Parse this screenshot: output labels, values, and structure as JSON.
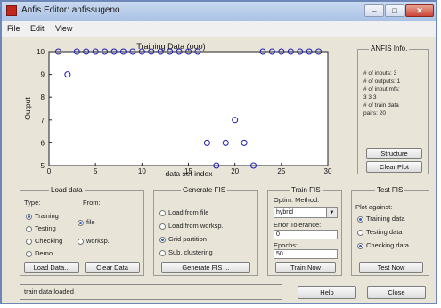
{
  "window": {
    "title": "Anfis Editor: anfissugeno",
    "controls": {
      "minimize": "–",
      "maximize": "□",
      "close": "✕"
    }
  },
  "menu": {
    "file": "File",
    "edit": "Edit",
    "view": "View"
  },
  "chart_data": {
    "type": "scatter",
    "title": "Training Data (ooo)",
    "xlabel": "data set index",
    "ylabel": "Output",
    "xlim": [
      0,
      30
    ],
    "ylim": [
      5,
      10
    ],
    "x_ticks": [
      0,
      5,
      10,
      15,
      20,
      25,
      30
    ],
    "y_ticks": [
      5,
      6,
      7,
      8,
      9,
      10
    ],
    "grid": false,
    "marker": "o",
    "marker_color": "#1a1ab4",
    "points": [
      {
        "x": 1,
        "y": 10
      },
      {
        "x": 2,
        "y": 9
      },
      {
        "x": 3,
        "y": 10
      },
      {
        "x": 4,
        "y": 10
      },
      {
        "x": 5,
        "y": 10
      },
      {
        "x": 6,
        "y": 10
      },
      {
        "x": 7,
        "y": 10
      },
      {
        "x": 8,
        "y": 10
      },
      {
        "x": 9,
        "y": 10
      },
      {
        "x": 10,
        "y": 10
      },
      {
        "x": 11,
        "y": 10
      },
      {
        "x": 12,
        "y": 10
      },
      {
        "x": 13,
        "y": 10
      },
      {
        "x": 14,
        "y": 10
      },
      {
        "x": 15,
        "y": 10
      },
      {
        "x": 16,
        "y": 10
      },
      {
        "x": 17,
        "y": 6
      },
      {
        "x": 18,
        "y": 5
      },
      {
        "x": 19,
        "y": 6
      },
      {
        "x": 20,
        "y": 7
      },
      {
        "x": 21,
        "y": 6
      },
      {
        "x": 22,
        "y": 5
      },
      {
        "x": 23,
        "y": 10
      },
      {
        "x": 24,
        "y": 10
      },
      {
        "x": 25,
        "y": 10
      },
      {
        "x": 26,
        "y": 10
      },
      {
        "x": 27,
        "y": 10
      },
      {
        "x": 28,
        "y": 10
      },
      {
        "x": 29,
        "y": 10
      }
    ]
  },
  "info": {
    "title": "ANFIS Info.",
    "lines": [
      "# of inputs: 3",
      "# of outputs: 1",
      "# of input mfs:",
      "3 3 3",
      "# of train data",
      "pairs: 20"
    ],
    "structure_button": "Structure",
    "clear_plot_button": "Clear Plot"
  },
  "load_data": {
    "title": "Load data",
    "type_label": "Type:",
    "from_label": "From:",
    "types": [
      {
        "label": "Training",
        "selected": true
      },
      {
        "label": "Testing",
        "selected": false
      },
      {
        "label": "Checking",
        "selected": false
      },
      {
        "label": "Demo",
        "selected": false
      }
    ],
    "sources": [
      {
        "label": "file",
        "selected": true
      },
      {
        "label": "worksp.",
        "selected": false
      }
    ],
    "load_button": "Load Data...",
    "clear_button": "Clear Data"
  },
  "generate_fis": {
    "title": "Generate FIS",
    "options": [
      {
        "label": "Load from file",
        "selected": false
      },
      {
        "label": "Load from worksp.",
        "selected": false
      },
      {
        "label": "Grid partition",
        "selected": true
      },
      {
        "label": "Sub. clustering",
        "selected": false
      }
    ],
    "button": "Generate FIS ..."
  },
  "train_fis": {
    "title": "Train FIS",
    "optim_label": "Optim. Method:",
    "method": "hybrid",
    "tolerance_label": "Error Tolerance:",
    "tolerance": "0",
    "epochs_label": "Epochs:",
    "epochs": "50",
    "button": "Train Now"
  },
  "test_fis": {
    "title": "Test FIS",
    "plot_against_label": "Plot against:",
    "options": [
      {
        "label": "Training data",
        "selected": true
      },
      {
        "label": "Testing data",
        "selected": false
      },
      {
        "label": "Checking data",
        "selected": false
      }
    ],
    "button": "Test Now"
  },
  "status": {
    "text": "train data loaded"
  },
  "bottom": {
    "help_button": "Help",
    "close_button": "Close"
  }
}
